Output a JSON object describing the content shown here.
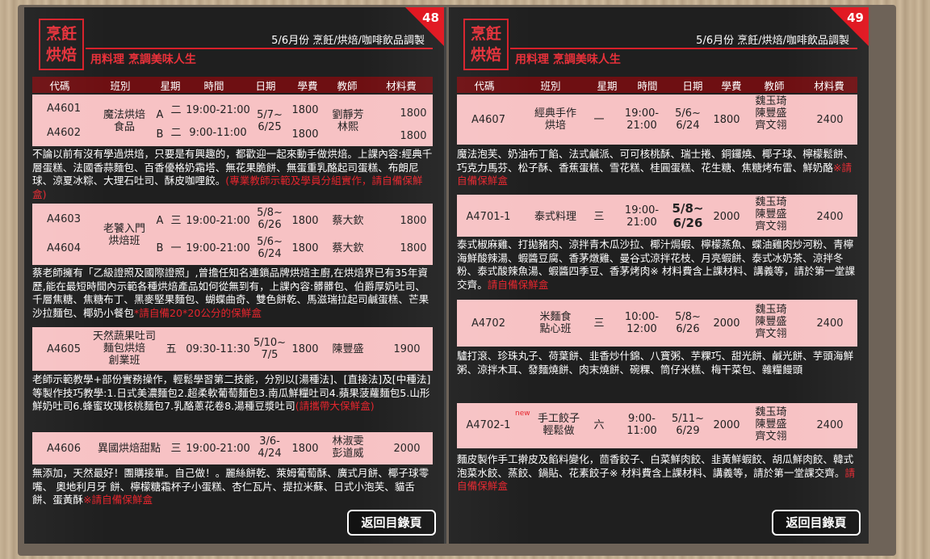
{
  "left": {
    "page_num": "48",
    "logo": [
      "烹飪",
      "烘焙"
    ],
    "header_title": "5/6月份 烹飪/烘焙/咖啡飲品調製",
    "subtitle": "用料理 烹調美味人生",
    "columns": [
      "代碼",
      "班別",
      "星期",
      "時間",
      "日期",
      "學費",
      "教師",
      "材料費"
    ],
    "rows": [
      {
        "code1": "A4601",
        "code2": "A4602",
        "class": "魔法烘焙\n食品",
        "sec1": "A",
        "sec2": "B",
        "day1": "二",
        "day2": "二",
        "time1": "19:00-21:00",
        "time2": "9:00-11:00",
        "date": "5/7~\n6/25",
        "fee1": "1800",
        "fee2": "1800",
        "teacher": "劉靜芳\n林熙",
        "mat1": "1800",
        "mat2": "1800"
      },
      {
        "code1": "A4603",
        "code2": "A4604",
        "class": "老饕入門\n烘焙班",
        "sec1": "A",
        "sec2": "B",
        "day1": "三",
        "day2": "一",
        "time1": "19:00-21:00",
        "time2": "19:00-21:00",
        "date1": "5/8~\n6/26",
        "date2": "5/6~\n6/24",
        "fee1": "1800",
        "fee2": "1800",
        "teacher1": "蔡大欽",
        "teacher2": "蔡大欽",
        "mat1": "1800",
        "mat2": "1800"
      },
      {
        "code": "A4605",
        "class": "天然蔬果吐司\n麵包烘焙\n創業班",
        "day": "五",
        "time": "09:30-11:30",
        "date": "5/10~\n7/5",
        "fee": "1800",
        "teacher": "陳豐盛",
        "mat": "1900"
      },
      {
        "code": "A4606",
        "class": "異國烘焙甜點",
        "day": "三",
        "time": "19:00-21:00",
        "date": "3/6-\n4/24",
        "fee": "1800",
        "teacher": "林淑雯\n彭道威",
        "mat": "2000"
      }
    ],
    "desc1": "不論以前有沒有學過烘焙，只要是有興趣的，都歡迎一起來動手做烘焙。上課內容:經典千層蛋糕、法國香蒜麵包、百香優格奶霜塔、無花果脆餅、無蛋重乳酪起司蛋糕、布朗尼球、涼夏冰粽、大理石吐司、酥皮咖哩餃。",
    "desc1_red": "(專業教師示範及學員分組實作，請自備保鮮盒)",
    "desc2": "蔡老師擁有「乙級證照及國際證照」,曾擔任知名連鎖品牌烘焙主廚,在烘焙界已有35年資歷,能在最短時間內示範各種烘焙產品如何從無到有，上課內容:髒髒包、伯爵厚奶吐司、千層焦糖、焦糖布丁、黑麥堅果麵包、蝴蝶曲奇、雙色餅乾、馬滋瑞拉起司鹹蛋糕、芒果沙拉麵包、椰奶小餐包",
    "desc2_red": "*請自備20*20公分的保鮮盒",
    "desc3": "老師示範教學+部份實務操作，輕鬆學習第二技能，分別以[湯種法]、[直接法]及[中種法]等製作技巧教學:1.日式美濃麵包2.超柔軟葡萄麵包3.南瓜鮮糧吐司4.蘋果菠蘿麵包5.山形鮮奶吐司6.蜂蜜玫瑰核桃麵包7.乳酪蔥花卷8.湯種豆漿吐司",
    "desc3_red": "(請攜帶大保鮮盒)",
    "desc4": "無添加，天然最好！團購接單。自己做！。麗絲餅乾、萊姆葡萄酥、廣式月餅、椰子球零嘴、 奧地利月牙 餅、檸檬糖霜杯子小蛋糕、杏仁瓦片、提拉米蘇、日式小泡芙、貓舌餅、蛋黃酥",
    "desc4_red": "※請自備保鮮盒",
    "back": "返回目錄頁"
  },
  "right": {
    "page_num": "49",
    "logo": [
      "烹飪",
      "烘焙"
    ],
    "header_title": "5/6月份 烹飪/烘焙/咖啡飲品調製",
    "subtitle": "用料理 烹調美味人生",
    "columns": [
      "代碼",
      "班別",
      "星期",
      "時間",
      "日期",
      "學費",
      "教師",
      "材料費"
    ],
    "rows": [
      {
        "code": "A4607",
        "class": "經典手作\n烘培",
        "day": "一",
        "time": "19:00-\n21:00",
        "date": "5/6~\n6/24",
        "fee": "1800",
        "teacher": "魏玉琦\n陳豐盛\n齊文翎",
        "mat": "2400"
      },
      {
        "code": "A4701-1",
        "class": "泰式料理",
        "day": "三",
        "time": "19:00-\n21:00",
        "date": "5/8~\n6/26",
        "fee": "2000",
        "teacher": "魏玉琦\n陳豐盛\n齊文翎",
        "mat": "2400"
      },
      {
        "code": "A4702",
        "class": "米麵食\n點心班",
        "day": "三",
        "time": "10:00-\n12:00",
        "date": "5/8~\n6/26",
        "fee": "2000",
        "teacher": "魏玉琦\n陳豐盛\n齊文翎",
        "mat": "2400"
      },
      {
        "code": "A4702-1",
        "new": "new",
        "class": "手工餃子\n輕鬆做",
        "day": "六",
        "time": "9:00-\n11:00",
        "date": "5/11~\n6/29",
        "fee": "2000",
        "teacher": "魏玉琦\n陳豐盛\n齊文翎",
        "mat": "2400"
      }
    ],
    "desc1": "魔法泡芙、奶油布丁餡、法式鹹派、可可核桃酥、瑞士捲、銅鑼燒、椰子球、檸檬鬆餅、巧克力馬芬、松子酥、香蕉蛋糕、雪花糕、桂圓蛋糕、花生糖、焦糖烤布雷、鮮奶酪",
    "desc1_red": "※請自備保鮮盒",
    "desc2": "泰式椒麻雞、打拋豬肉、涼拌青木瓜沙拉、椰汁焗蝦、檸檬蒸魚、蝶油雞肉炒河粉、青檸海鮮酸辣湯、蝦醬豆腐、香茅燉雞、曼谷式涼拌花枝、月亮蝦餅、泰式冰奶茶、涼拌冬粉、泰式酸辣魚湯、蝦醬四季豆、香茅烤肉※ 材料費含上課材料、講義等，請於第一堂課交齊。",
    "desc2_red": "請自備保鮮盒",
    "desc3": "驢打滾、珍珠丸子、荷葉餅、韭香炒什錦、八寶粥、芋粿巧、甜光餅、鹹光餅、芋頭海鮮粥、涼拌木耳、發麵燒餅、肉末燒餅、碗粿、筒仔米糕、梅干菜包、雜糧饅頭",
    "desc4": "麵皮製作手工擀皮及餡料變化，茴香餃子、白菜鮮肉餃、韭黃鮮蝦餃、胡瓜鮮肉餃、韓式泡菜水餃、蒸餃、鍋貼、花素餃子※ 材料費含上課材料、講義等，請於第一堂課交齊。",
    "desc4_red": "請自備保鮮盒",
    "back": "返回目錄頁"
  }
}
